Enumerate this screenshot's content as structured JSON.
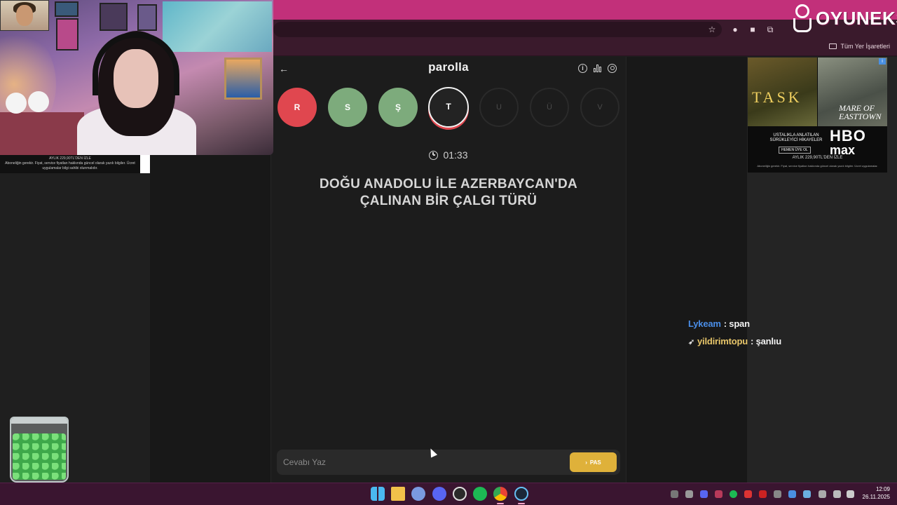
{
  "browser": {
    "bookmarks_all_label": "Tüm Yer İşaretleri"
  },
  "logo": {
    "text": "OYUNEKS"
  },
  "webcam": {
    "ad_strip_label": "AYLIK 229,90TL'DEN İZLE",
    "ad_strip_fine": "Aboneliğin gerekir. Fiyat, service fiyatları hakkında güncel olarak yazılı bilgiler. Ücret uygulamalar bilgi sahibi olunmalıdır."
  },
  "ad_right": {
    "title_1": "TASK",
    "title_2": "MARE OF EASTTOWN",
    "tagline": "USTALIKLA ANLATILAN SÜRÜKLEYİCİ HİKAYELER",
    "button": "HEMEN ÜYE OL",
    "brand_1": "HBO",
    "brand_2": "max",
    "price": "AYLIK 229,90TL'DEN İZLE",
    "fine_print": "Aboneliğin gerekir. Fiyat, service fiyatları hakkında güncel olarak yazılı bilgiler. Ücret uygulamalar."
  },
  "game": {
    "title": "parolla",
    "timer": "01:33",
    "question_line_1": "DOĞU ANADOLU İLE AZERBAYCAN'DA",
    "question_line_2": "ÇALINAN BİR ÇALGI TÜRÜ",
    "letters": [
      {
        "letter": "R",
        "state": "wrong"
      },
      {
        "letter": "S",
        "state": "right"
      },
      {
        "letter": "Ş",
        "state": "right"
      },
      {
        "letter": "T",
        "state": "active"
      },
      {
        "letter": "U",
        "state": "pending"
      },
      {
        "letter": "Ü",
        "state": "pending"
      },
      {
        "letter": "V",
        "state": "pending"
      }
    ],
    "answer_placeholder": "Cevabı Yaz",
    "pass_label": "PAS",
    "colors": {
      "wrong": "#e0474f",
      "right": "#7dab7c",
      "pass": "#dfb13a"
    }
  },
  "chat": [
    {
      "user": "Lykeam",
      "message": ": span",
      "user_color": "#4a8ee8"
    },
    {
      "user": "yildirimtopu",
      "message": ": şanlıu",
      "user_color": "#e8c66a",
      "badge_icon": "rocket-icon"
    }
  ],
  "taskbar": {
    "time": "12:09",
    "date": "26.11.2025",
    "icons": [
      "windows-start-icon",
      "file-explorer-icon",
      "app-icon",
      "discord-icon",
      "obs-icon",
      "spotify-icon",
      "chrome-icon",
      "steam-icon"
    ]
  }
}
